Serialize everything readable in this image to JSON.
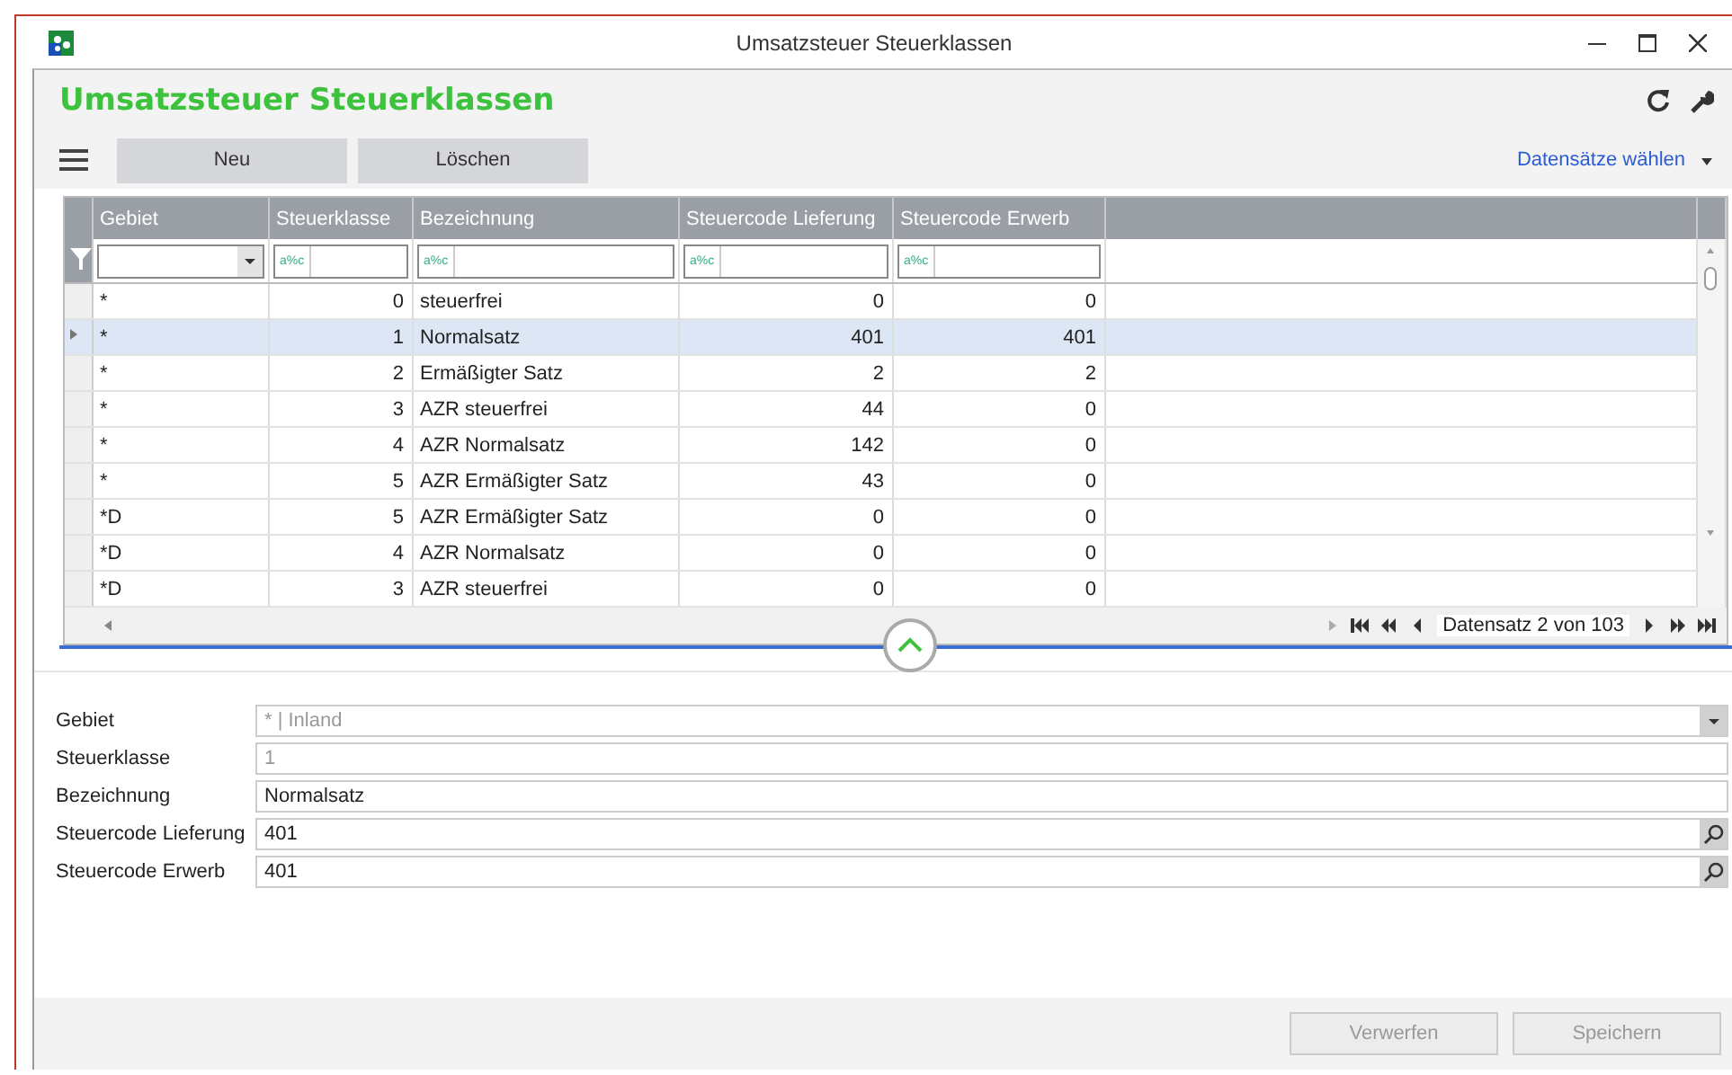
{
  "window": {
    "title": "Umsatzsteuer Steuerklassen"
  },
  "page_title": "Umsatzsteuer Steuerklassen",
  "toolbar": {
    "buttons": [
      "Neu",
      "Löschen"
    ],
    "record_menu": "Datensätze wählen"
  },
  "table": {
    "columns": [
      "Gebiet",
      "Steuerklasse",
      "Bezeichnung",
      "Steuercode Lieferung",
      "Steuercode Erwerb"
    ],
    "filters": [
      {
        "kind": "dropdown"
      },
      {
        "kind": "text",
        "placeholder": "a%c"
      },
      {
        "kind": "text",
        "placeholder": "a%c"
      },
      {
        "kind": "text",
        "placeholder": "a%c"
      },
      {
        "kind": "text",
        "placeholder": "a%c"
      }
    ],
    "rows": [
      {
        "cells": [
          "*",
          "0",
          "steuerfrei",
          "0",
          "0"
        ],
        "selected": false
      },
      {
        "cells": [
          "*",
          "1",
          "Normalsatz",
          "401",
          "401"
        ],
        "selected": true
      },
      {
        "cells": [
          "*",
          "2",
          "Ermäßigter Satz",
          "2",
          "2"
        ],
        "selected": false
      },
      {
        "cells": [
          "*",
          "3",
          "AZR steuerfrei",
          "44",
          "0"
        ],
        "selected": false
      },
      {
        "cells": [
          "*",
          "4",
          "AZR Normalsatz",
          "142",
          "0"
        ],
        "selected": false
      },
      {
        "cells": [
          "*",
          "5",
          "AZR Ermäßigter Satz",
          "43",
          "0"
        ],
        "selected": false
      },
      {
        "cells": [
          "*D",
          "5",
          "AZR Ermäßigter Satz",
          "0",
          "0"
        ],
        "selected": false
      },
      {
        "cells": [
          "*D",
          "4",
          "AZR Normalsatz",
          "0",
          "0"
        ],
        "selected": false
      },
      {
        "cells": [
          "*D",
          "3",
          "AZR steuerfrei",
          "0",
          "0"
        ],
        "selected": false
      }
    ],
    "pager": "Datensatz 2 von 103"
  },
  "form": [
    {
      "label": "Gebiet",
      "value": "* | Inland",
      "kind": "dropdown",
      "disabled": true
    },
    {
      "label": "Steuerklasse",
      "value": "1",
      "kind": "text",
      "disabled": true
    },
    {
      "label": "Bezeichnung",
      "value": "Normalsatz",
      "kind": "text",
      "disabled": false
    },
    {
      "label": "Steuercode Lieferung",
      "value": "401",
      "kind": "lookup",
      "disabled": false
    },
    {
      "label": "Steuercode Erwerb",
      "value": "401",
      "kind": "lookup",
      "disabled": false
    }
  ],
  "footer": {
    "buttons": [
      {
        "label": "Verwerfen",
        "disabled": true
      },
      {
        "label": "Speichern",
        "disabled": true
      }
    ]
  }
}
